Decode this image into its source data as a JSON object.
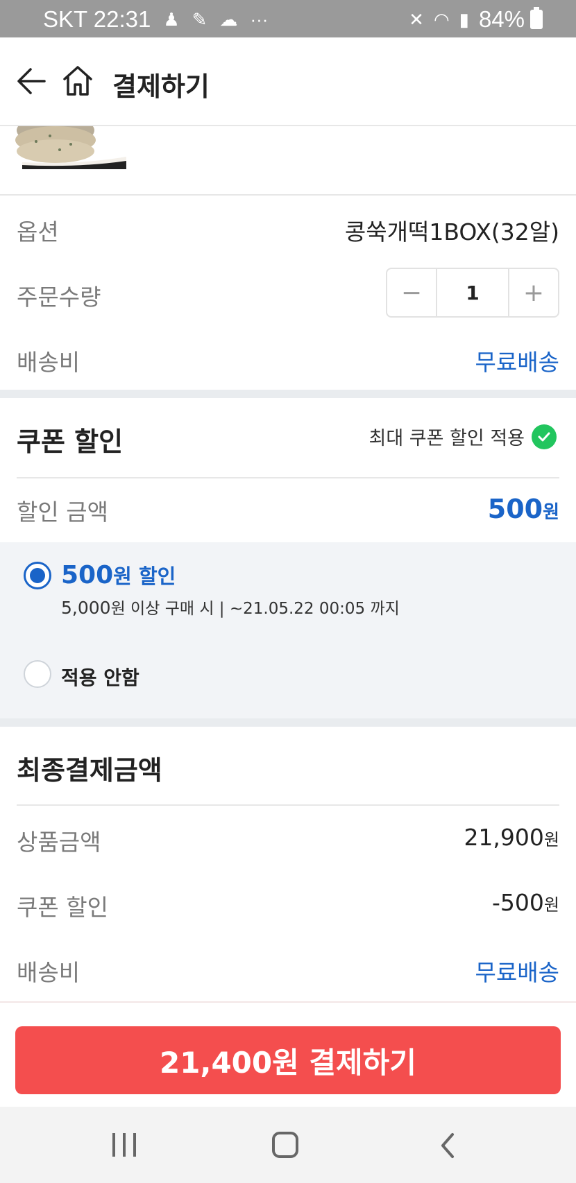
{
  "status_bar": {
    "carrier_time": "SKT 22:31",
    "more": "···",
    "battery": "84%"
  },
  "header": {
    "title": "결제하기"
  },
  "order": {
    "option_label": "옵션",
    "option_value": "콩쑥개떡1BOX(32알)",
    "qty_label": "주문수량",
    "qty_minus": "−",
    "qty_value": "1",
    "qty_plus": "+",
    "shipping_label": "배송비",
    "shipping_value": "무료배송"
  },
  "coupon": {
    "title": "쿠폰 할인",
    "max_applied": "최대 쿠폰 할인 적용",
    "discount_label": "할인 금액",
    "discount_value": "500",
    "won": "원",
    "option1_amount": "500",
    "option1_won": "원",
    "option1_text": " 할인",
    "option1_condition_amount": "5,000",
    "option1_condition_won": "원",
    "option1_condition_rest": " 이상 구매 시 |  ~21.05.22 00:05 까지",
    "option2_label": "적용 안함"
  },
  "final": {
    "title": "최종결제금액",
    "product_label": "상품금액",
    "product_value": "21,900",
    "coupon_label": "쿠폰 할인",
    "coupon_value": "-500",
    "shipping_label": "배송비",
    "shipping_value": "무료배송",
    "won": "원"
  },
  "pay_button": "21,400원 결제하기",
  "colors": {
    "accent_blue": "#1a64c8",
    "pay_red": "#f44e4e",
    "check_green": "#22c55e"
  }
}
